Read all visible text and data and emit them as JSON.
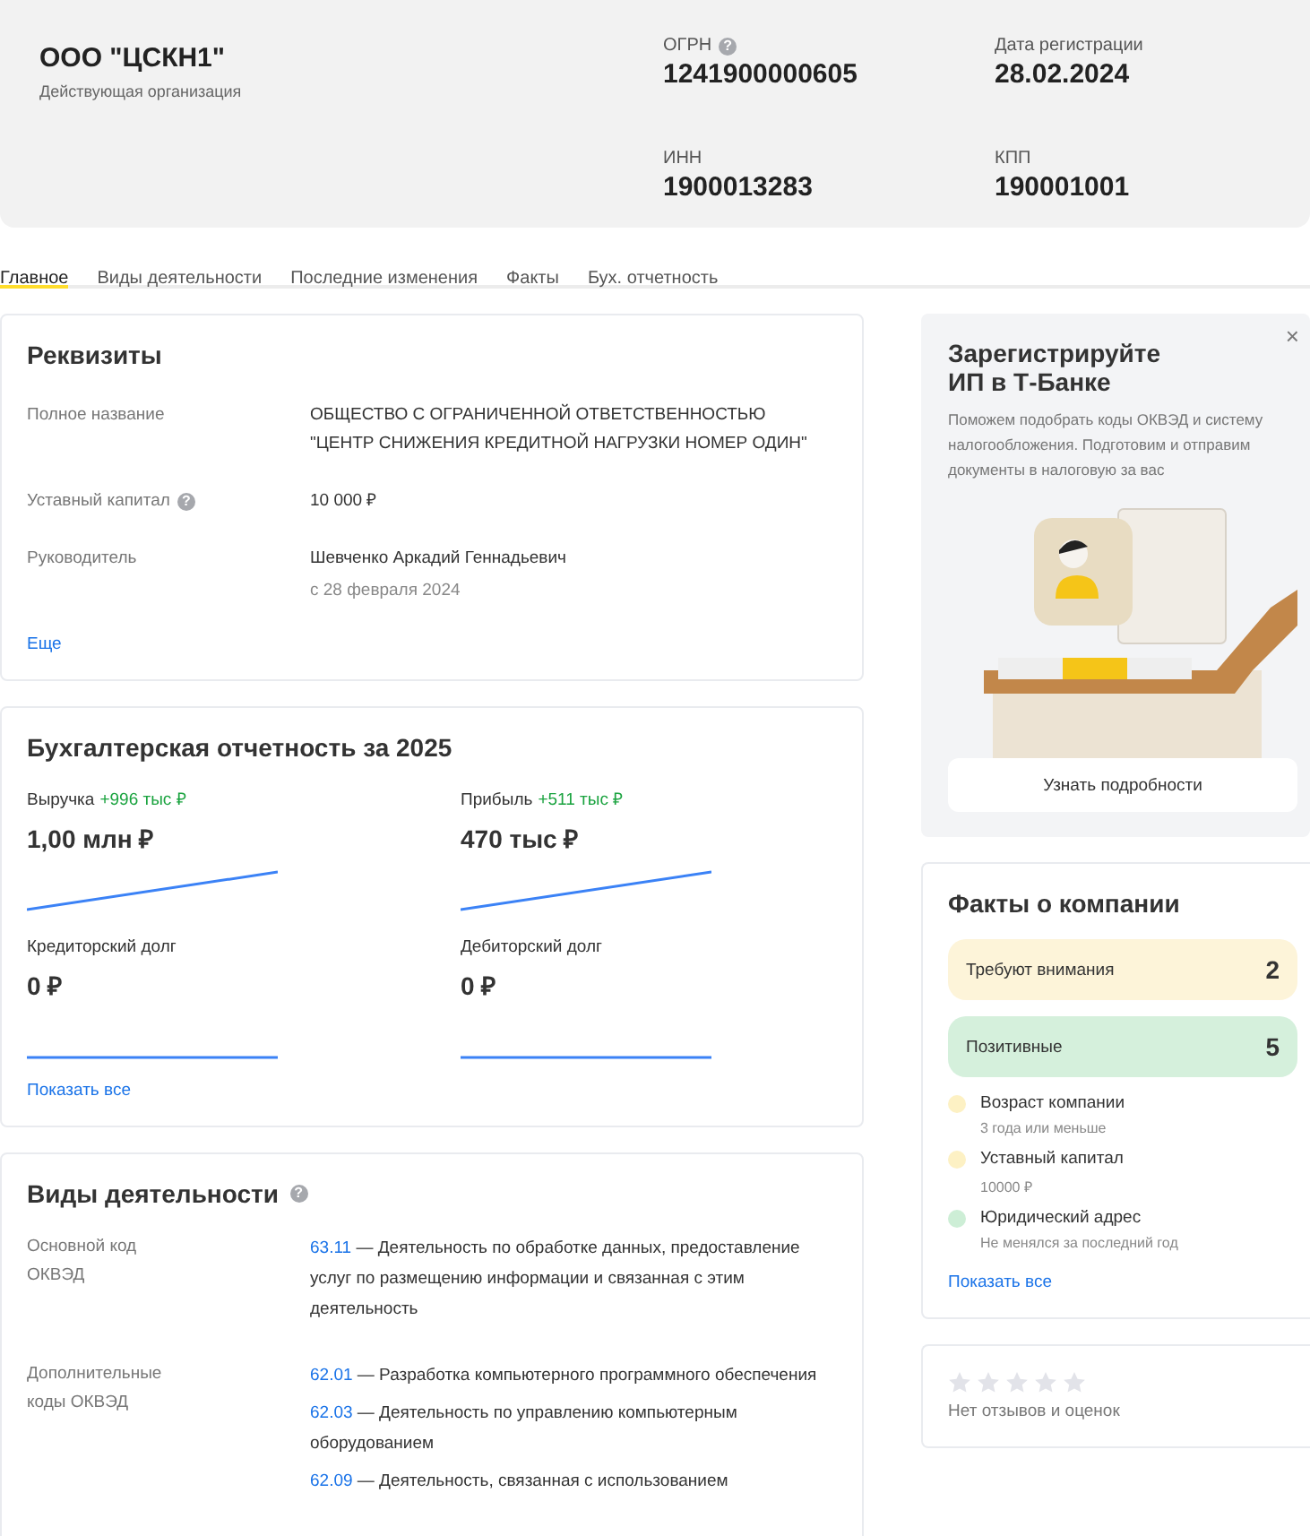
{
  "header": {
    "title": "ООО \"ЦСКН1\"",
    "status": "Действующая организация",
    "fields": [
      {
        "label": "ОГРН",
        "value": "1241900000605",
        "help_icon": "?"
      },
      {
        "label": "Дата регистрации",
        "value": "28.02.2024"
      },
      {
        "label": "ИНН",
        "value": "1900013283"
      },
      {
        "label": "КПП",
        "value": "190001001"
      }
    ]
  },
  "tabs": [
    {
      "label": "Главное",
      "selected": true
    },
    {
      "label": "Виды деятельности",
      "selected": false
    },
    {
      "label": "Последние изменения",
      "selected": false
    },
    {
      "label": "Факты",
      "selected": false
    },
    {
      "label": "Бух. отчетность",
      "selected": false
    }
  ],
  "requisites": {
    "title": "Реквизиты",
    "rows": [
      {
        "label": "Полное название",
        "lines": [
          "ОБЩЕСТВО С ОГРАНИЧЕННОЙ ОТВЕТСТВЕННОСТЬЮ",
          "\"ЦЕНТР СНИЖЕНИЯ КРЕДИТНОЙ НАГРУЗКИ НОМЕР ОДИН\""
        ]
      },
      {
        "label": "Уставный капитал",
        "help_icon": "?",
        "lines": [
          "10 000 ₽"
        ]
      },
      {
        "label": "Руководитель",
        "lines": [
          "Шевченко Аркадий Геннадьевич"
        ],
        "note": "с 28 февраля 2024"
      }
    ],
    "more_link": "Еще"
  },
  "accounting": {
    "title": "Бухгалтерская отчетность за 2025",
    "metrics": [
      {
        "label": "Выручка",
        "change": "+996 тыс ₽",
        "value": "1,00 млн ₽",
        "kind": "rising"
      },
      {
        "label": "Прибыль",
        "change": "+511 тыс ₽",
        "value": "470 тыс ₽",
        "kind": "rising"
      },
      {
        "label": "Кредиторский долг",
        "value": "0 ₽",
        "kind": "flat"
      },
      {
        "label": "Дебиторский долг",
        "value": "0 ₽",
        "kind": "flat"
      }
    ],
    "show_all_link": "Показать все"
  },
  "activities": {
    "title": "Виды деятельности",
    "help_icon": "?",
    "groups": [
      {
        "label": "Основной код ОКВЭД",
        "items": [
          {
            "code": "63.11",
            "text": "— Деятельность по обработке данных, предоставление услуг по размещению информации и связанная с этим деятельность"
          }
        ]
      },
      {
        "label": "Дополнительные коды ОКВЭД",
        "items": [
          {
            "code": "62.01",
            "text": "— Разработка компьютерного программного обеспечения"
          },
          {
            "code": "62.03",
            "text": "— Деятельность по управлению компьютерным оборудованием"
          },
          {
            "code": "62.09",
            "text": "— Деятельность, связанная с использованием"
          }
        ]
      }
    ]
  },
  "promo": {
    "title": "Зарегистрируйте ИП в Т-Банке",
    "text": "Поможем подобрать коды ОКВЭД и систему налогообложения. Подготовим и отправим документы в налоговую за вас",
    "button": "Узнать подробности",
    "close": "×"
  },
  "facts": {
    "title": "Факты о компании",
    "summary": [
      {
        "label": "Требуют внимания",
        "count": "2",
        "color": "#fdf4d9"
      },
      {
        "label": "Позитивные",
        "count": "5",
        "color": "#d5f0dc"
      }
    ],
    "items": [
      {
        "title": "Возраст компании",
        "note": "3 года или меньше",
        "color": "#fdf1c4"
      },
      {
        "title": "Уставный капитал",
        "note": "10000 ₽",
        "color": "#fdf1c4"
      },
      {
        "title": "Юридический адрес",
        "note": "Не менялся за последний год",
        "color": "#cdeed6"
      }
    ],
    "show_all_link": "Показать все"
  },
  "reviews": {
    "stars": 0,
    "text": "Нет отзывов и оценок"
  }
}
